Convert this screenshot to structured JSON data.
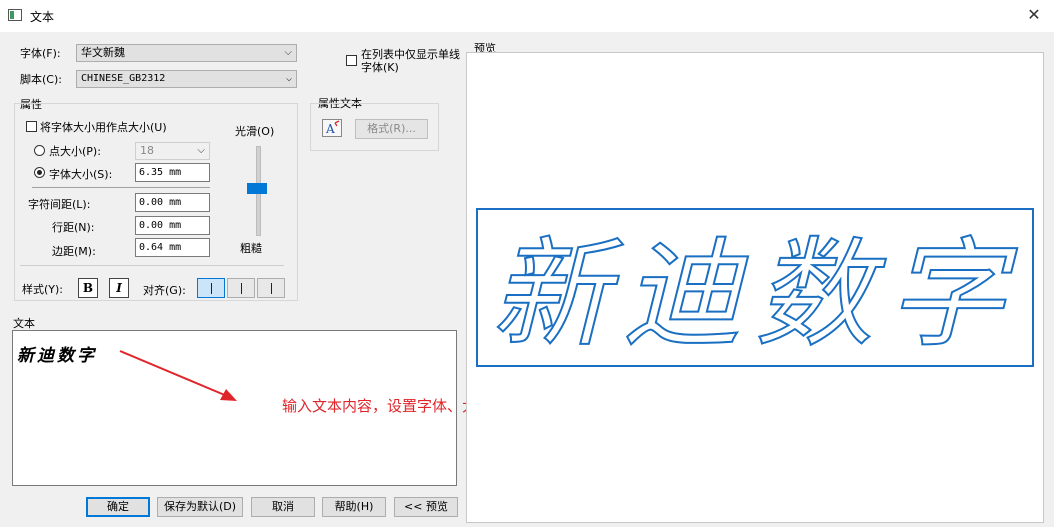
{
  "window": {
    "title": "文本"
  },
  "font": {
    "label": "字体(F):",
    "value": "华文新魏",
    "script_label": "脚本(C):",
    "script_value": "CHINESE_GB2312",
    "only_single_line_label": "在列表中仅显示单线字体(K)"
  },
  "attributes": {
    "group_label": "属性",
    "use_point_size_label": "将字体大小用作点大小(U)",
    "point_size_label": "点大小(P):",
    "point_size_value": "18",
    "font_size_label": "字体大小(S):",
    "font_size_value": "6.35 mm",
    "char_spacing_label": "字符间距(L):",
    "char_spacing_value": "0.00 mm",
    "line_spacing_label": "行距(N):",
    "line_spacing_value": "0.00 mm",
    "margin_label": "边距(M):",
    "margin_value": "0.64 mm",
    "smooth_label": "光滑(O)",
    "rough_label": "粗糙",
    "style_label": "样式(Y):",
    "bold_label": "B",
    "italic_label": "I",
    "align_label": "对齐(G):"
  },
  "attr_text": {
    "group_label": "属性文本",
    "format_button": "格式(R)..."
  },
  "text": {
    "label": "文本",
    "content": "新迪数字"
  },
  "annotation": {
    "note": "输入文本内容，设置字体、大小、间距等参数"
  },
  "preview": {
    "label": "预览",
    "content": "新迪数字"
  },
  "buttons": {
    "ok": "确定",
    "save_default": "保存为默认(D)",
    "cancel": "取消",
    "help": "帮助(H)",
    "preview": "<< 预览"
  },
  "colors": {
    "accent": "#0078d7",
    "note": "#e0252a",
    "preview_outline": "#1a6fc2"
  }
}
